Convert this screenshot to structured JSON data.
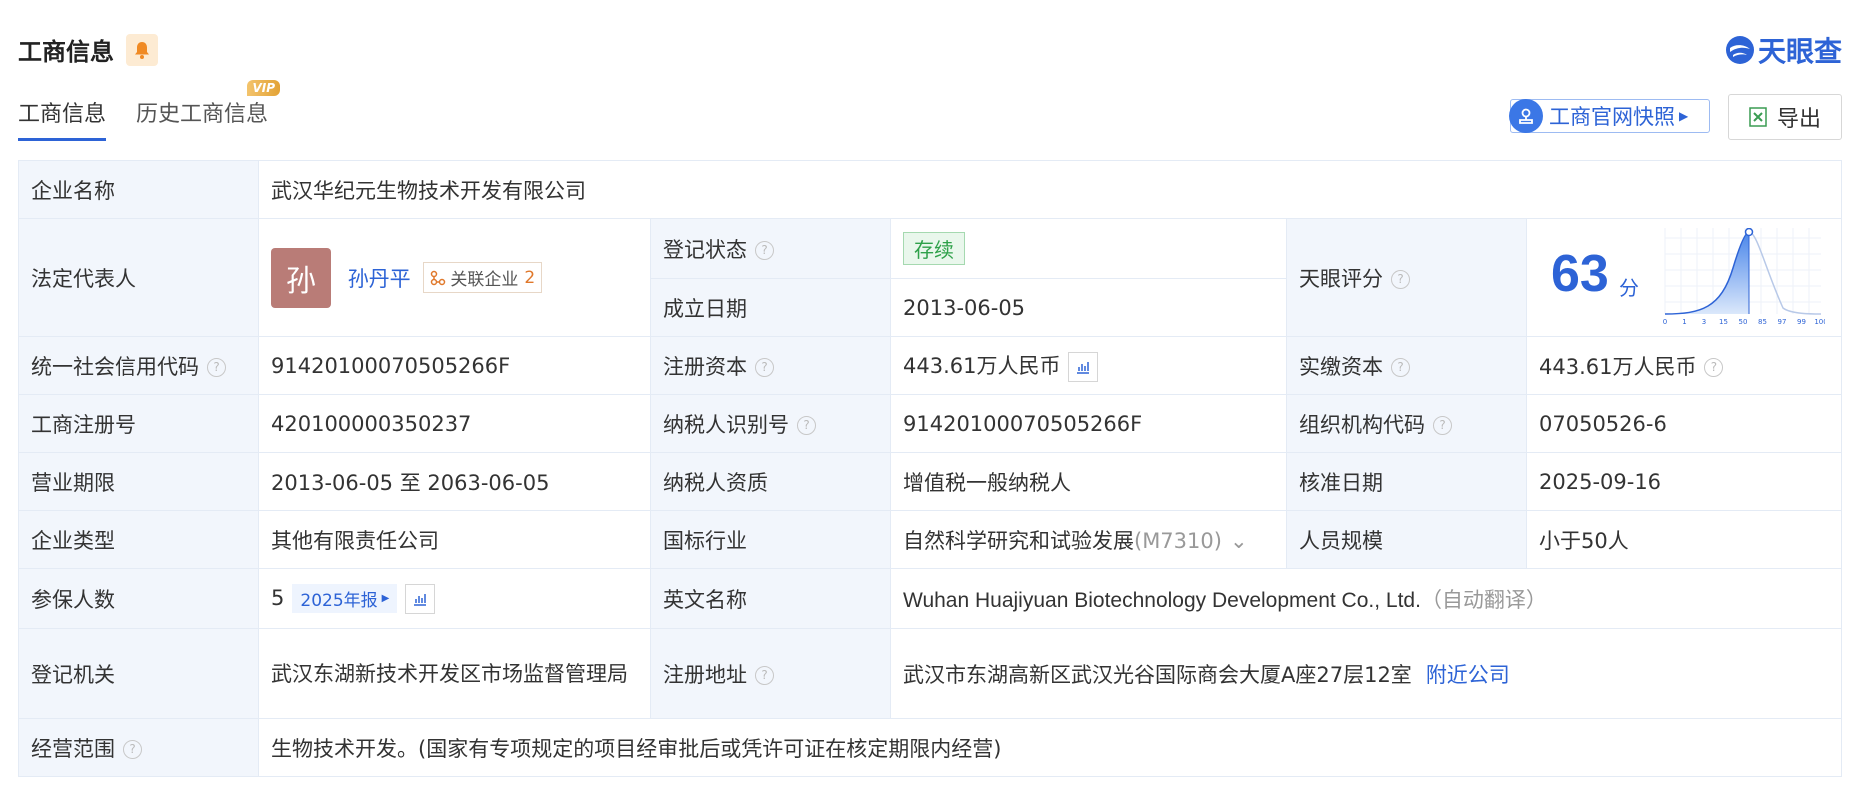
{
  "header": {
    "title": "工商信息",
    "brand": "天眼查"
  },
  "tabs": [
    {
      "label": "工商信息"
    },
    {
      "label": "历史工商信息"
    }
  ],
  "vip": "VIP",
  "buttons": {
    "snapshot": "工商官网快照",
    "export": "导出"
  },
  "rows": {
    "company_name": {
      "label": "企业名称",
      "value": "武汉华纪元生物技术开发有限公司"
    },
    "legal_rep": {
      "label": "法定代表人",
      "avatar_char": "孙",
      "name": "孙丹平",
      "related_label": "关联企业",
      "related_count": "2"
    },
    "reg_status": {
      "label": "登记状态",
      "value": "存续"
    },
    "founded": {
      "label": "成立日期",
      "value": "2013-06-05"
    },
    "tyc_score": {
      "label": "天眼评分",
      "score": "63",
      "unit": "分",
      "ticks": [
        "0",
        "1",
        "3",
        "15",
        "50",
        "85",
        "97",
        "99",
        "100"
      ]
    },
    "credit_code": {
      "label": "统一社会信用代码",
      "value": "91420100070505266F"
    },
    "reg_capital": {
      "label": "注册资本",
      "value": "443.61万人民币"
    },
    "paid_capital": {
      "label": "实缴资本",
      "value": "443.61万人民币"
    },
    "reg_no": {
      "label": "工商注册号",
      "value": "420100000350237"
    },
    "taxpayer_id": {
      "label": "纳税人识别号",
      "value": "91420100070505266F"
    },
    "org_code": {
      "label": "组织机构代码",
      "value": "07050526-6"
    },
    "term": {
      "label": "营业期限",
      "value": "2013-06-05 至 2063-06-05"
    },
    "tax_qual": {
      "label": "纳税人资质",
      "value": "增值税一般纳税人"
    },
    "approval_date": {
      "label": "核准日期",
      "value": "2025-09-16"
    },
    "company_type": {
      "label": "企业类型",
      "value": "其他有限责任公司"
    },
    "industry": {
      "label": "国标行业",
      "value": "自然科学研究和试验发展",
      "code": "(M7310)"
    },
    "staff_size": {
      "label": "人员规模",
      "value": "小于50人"
    },
    "insured": {
      "label": "参保人数",
      "value": "5",
      "year_badge": "2025年报"
    },
    "english_name": {
      "label": "英文名称",
      "value": "Wuhan Huajiyuan Biotechnology Development Co., Ltd.",
      "note": "（自动翻译）"
    },
    "reg_authority": {
      "label": "登记机关",
      "value": "武汉东湖新技术开发区市场监督管理局"
    },
    "reg_address": {
      "label": "注册地址",
      "value": "武汉市东湖高新区武汉光谷国际商会大厦A座27层12室",
      "nearby": "附近公司"
    },
    "scope": {
      "label": "经营范围",
      "value": "生物技术开发。(国家有专项规定的项目经审批后或凭许可证在核定期限内经营)"
    }
  },
  "colors": {
    "accent": "#2d63d6",
    "label_bg": "#f2f6fc",
    "border": "#e4ebf5",
    "status_green": "#2fa14a"
  }
}
